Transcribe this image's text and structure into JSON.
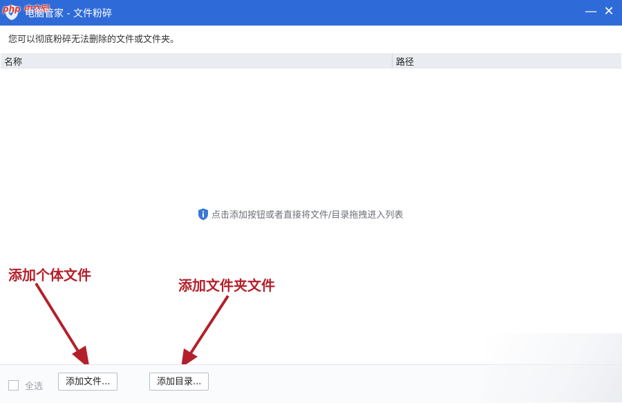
{
  "window": {
    "watermark": "php 中文网",
    "title": "电脑管家 - 文件粉碎",
    "minimize_icon": "minimize-icon",
    "close_icon": "close-icon",
    "minimize_glyph": "—",
    "close_glyph": "✕"
  },
  "subtitle": "您可以彻底粉碎无法删除的文件或文件夹。",
  "list": {
    "columns": [
      "名称",
      "路径"
    ],
    "empty_hint": "点击添加按钮或者直接将文件/目录拖拽进入列表",
    "hint_icon": "shield-info-icon"
  },
  "annotations": {
    "add_file_note": "添加个体文件",
    "add_folder_note": "添加文件夹文件",
    "arrow_color": "#b3202b"
  },
  "footer": {
    "select_all_label": "全选",
    "select_all_checked": false,
    "add_file_label": "添加文件...",
    "add_dir_label": "添加目录..."
  },
  "colors": {
    "titlebar": "#2f6bd8",
    "annotation": "#b3202b"
  }
}
